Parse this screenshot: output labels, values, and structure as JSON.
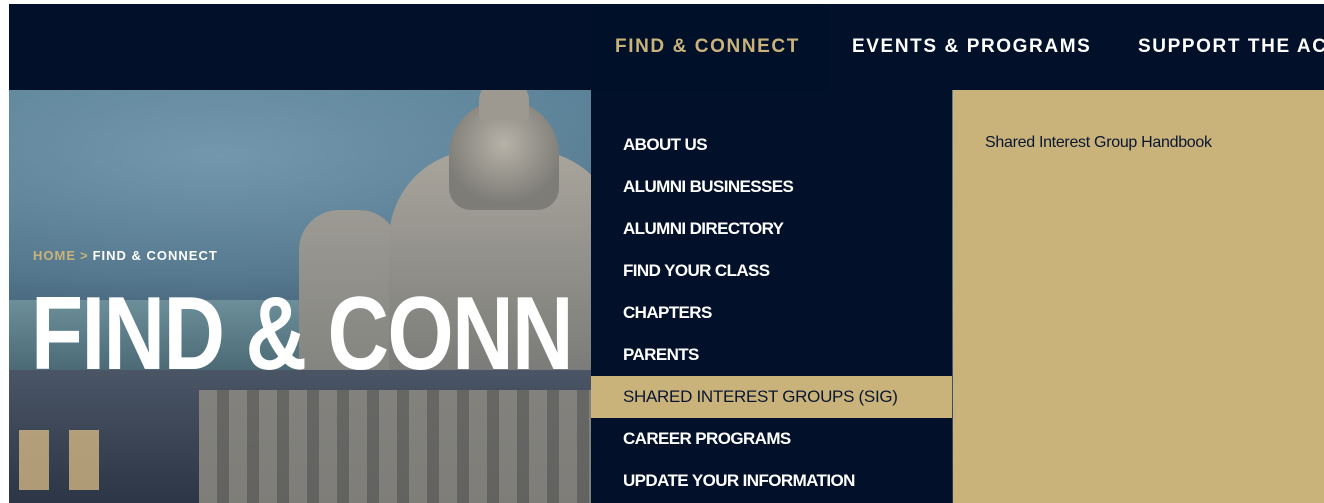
{
  "nav": {
    "items": [
      {
        "label": "FIND & CONNECT"
      },
      {
        "label": "EVENTS & PROGRAMS"
      },
      {
        "label": "SUPPORT THE AC"
      }
    ],
    "active_color": "#c9b37b",
    "bar_color": "#021029"
  },
  "hero": {
    "breadcrumb": {
      "home": "HOME",
      "separator": ">",
      "current": "FIND & CONNECT"
    },
    "title": "FIND & CONN"
  },
  "dropdown": {
    "items": [
      {
        "label": "ABOUT US"
      },
      {
        "label": "ALUMNI BUSINESSES"
      },
      {
        "label": "ALUMNI DIRECTORY"
      },
      {
        "label": "FIND YOUR CLASS"
      },
      {
        "label": "CHAPTERS"
      },
      {
        "label": "PARENTS"
      },
      {
        "label": "SHARED INTEREST GROUPS (SIG)"
      },
      {
        "label": "CAREER PROGRAMS"
      },
      {
        "label": "UPDATE YOUR INFORMATION"
      }
    ],
    "selected_label": "SHARED INTEREST GROUPS (SIG)",
    "submenu": {
      "links": [
        {
          "label": "Shared Interest Group Handbook"
        }
      ]
    },
    "highlight_color": "#c9b37b"
  }
}
